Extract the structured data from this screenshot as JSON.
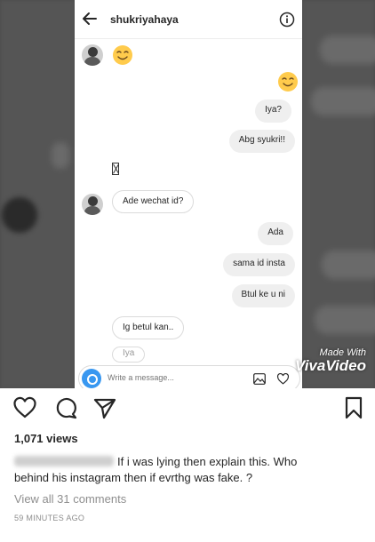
{
  "chat": {
    "username": "shukriyahaya",
    "messages": {
      "m1": "Iya?",
      "m2": "Abg syukri!!",
      "m3": "Ade wechat id?",
      "m4": "Ada",
      "m5": "sama id insta",
      "m6": "Btul ke u ni",
      "m7": "Ig betul kan..",
      "m8": "Iya"
    },
    "composer_placeholder": "Write a message..."
  },
  "watermark": {
    "line1": "Made With",
    "line2": "VivaVideo"
  },
  "post": {
    "views": "1,071 views",
    "caption_line1": "If i was lying then explain this. Who",
    "caption_line2": "behind his instagram then if evrthg was fake. ?",
    "view_comments": "View all 31 comments",
    "timestamp": "59 MINUTES AGO"
  },
  "colors": {
    "accent": "#3897f0",
    "text": "#262626",
    "muted": "#8e8e8e"
  },
  "icons": [
    "back-arrow-icon",
    "info-icon",
    "camera-icon",
    "gallery-icon",
    "heart-icon",
    "comment-icon",
    "share-icon",
    "bookmark-icon",
    "smiley-emoji"
  ]
}
